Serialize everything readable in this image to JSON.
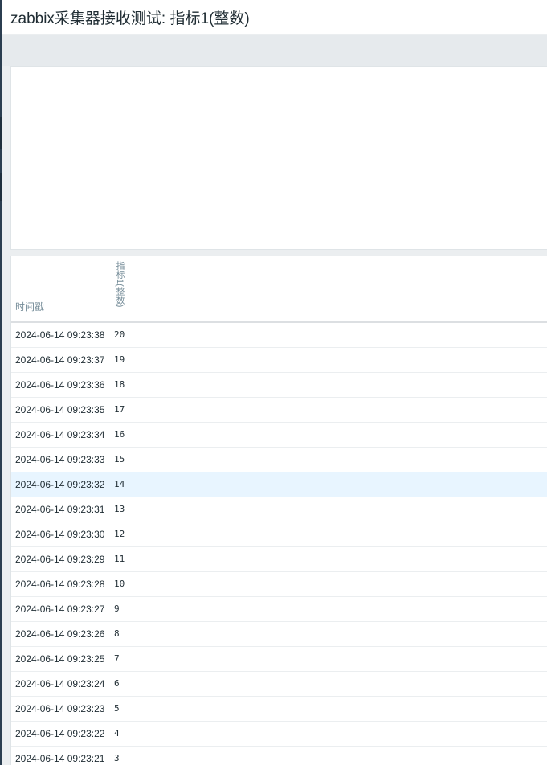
{
  "header": {
    "title": "zabbix采集器接收测试: 指标1(整数)"
  },
  "table": {
    "columns": {
      "timestamp": "时间戳",
      "value": "指标1(整数)"
    },
    "rows": [
      {
        "timestamp": "2024-06-14 09:23:38",
        "value": "20"
      },
      {
        "timestamp": "2024-06-14 09:23:37",
        "value": "19"
      },
      {
        "timestamp": "2024-06-14 09:23:36",
        "value": "18"
      },
      {
        "timestamp": "2024-06-14 09:23:35",
        "value": "17"
      },
      {
        "timestamp": "2024-06-14 09:23:34",
        "value": "16"
      },
      {
        "timestamp": "2024-06-14 09:23:33",
        "value": "15"
      },
      {
        "timestamp": "2024-06-14 09:23:32",
        "value": "14"
      },
      {
        "timestamp": "2024-06-14 09:23:31",
        "value": "13"
      },
      {
        "timestamp": "2024-06-14 09:23:30",
        "value": "12"
      },
      {
        "timestamp": "2024-06-14 09:23:29",
        "value": "11"
      },
      {
        "timestamp": "2024-06-14 09:23:28",
        "value": "10"
      },
      {
        "timestamp": "2024-06-14 09:23:27",
        "value": "9"
      },
      {
        "timestamp": "2024-06-14 09:23:26",
        "value": "8"
      },
      {
        "timestamp": "2024-06-14 09:23:25",
        "value": "7"
      },
      {
        "timestamp": "2024-06-14 09:23:24",
        "value": "6"
      },
      {
        "timestamp": "2024-06-14 09:23:23",
        "value": "5"
      },
      {
        "timestamp": "2024-06-14 09:23:22",
        "value": "4"
      },
      {
        "timestamp": "2024-06-14 09:23:21",
        "value": "3"
      }
    ],
    "highlighted_row": 6
  },
  "colors": {
    "sidebar": "#2b3e50",
    "filter_bar": "#e6eaed",
    "row_highlight": "#e8f5ff",
    "header_text": "#768d99",
    "text": "#1f2c33"
  }
}
